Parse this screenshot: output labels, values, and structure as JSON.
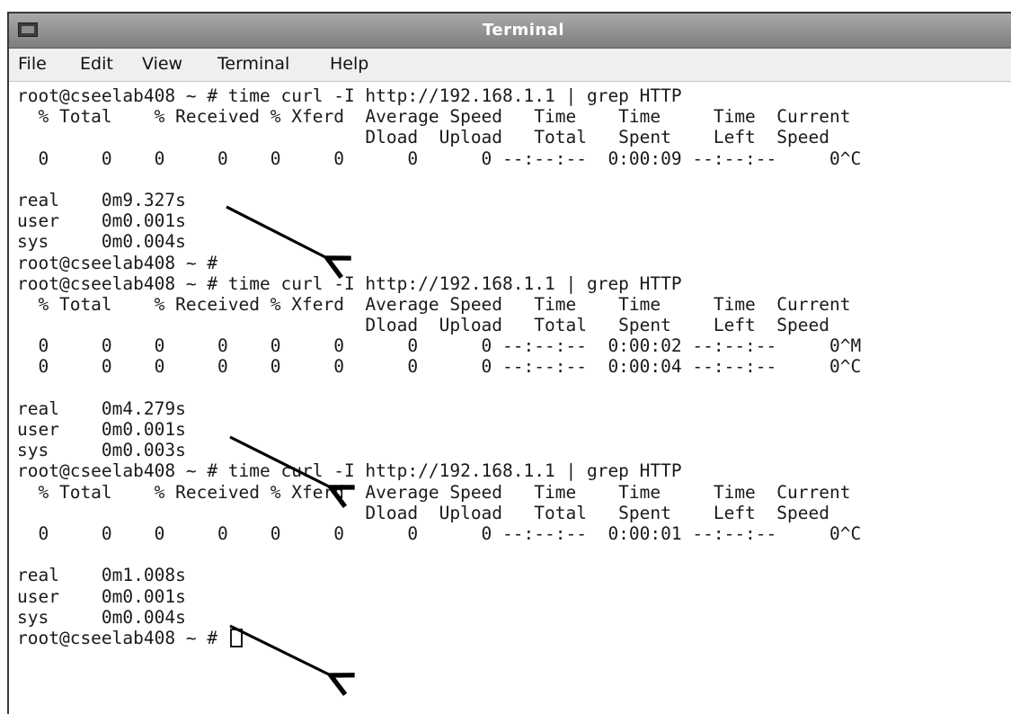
{
  "window": {
    "title": "Terminal",
    "app_icon": "terminal-app-icon"
  },
  "menu": [
    "File",
    "Edit",
    "View",
    "Terminal",
    "Help"
  ],
  "terminal": {
    "lines": [
      "root@cseelab408 ~ # time curl -I http://192.168.1.1 | grep HTTP",
      "  % Total    % Received % Xferd  Average Speed   Time    Time     Time  Current",
      "                                 Dload  Upload   Total   Spent    Left  Speed",
      "  0     0    0     0    0     0      0      0 --:--:--  0:00:09 --:--:--     0^C",
      "",
      "real    0m9.327s",
      "user    0m0.001s",
      "sys     0m0.004s",
      "root@cseelab408 ~ #",
      "root@cseelab408 ~ # time curl -I http://192.168.1.1 | grep HTTP",
      "  % Total    % Received % Xferd  Average Speed   Time    Time     Time  Current",
      "                                 Dload  Upload   Total   Spent    Left  Speed",
      "  0     0    0     0    0     0      0      0 --:--:--  0:00:02 --:--:--     0^M",
      "  0     0    0     0    0     0      0      0 --:--:--  0:00:04 --:--:--     0^C",
      "",
      "real    0m4.279s",
      "user    0m0.001s",
      "sys     0m0.003s",
      "root@cseelab408 ~ # time curl -I http://192.168.1.1 | grep HTTP",
      "  % Total    % Received % Xferd  Average Speed   Time    Time     Time  Current",
      "                                 Dload  Upload   Total   Spent    Left  Speed",
      "  0     0    0     0    0     0      0      0 --:--:--  0:00:01 --:--:--     0^C",
      "",
      "real    0m1.008s",
      "user    0m0.001s",
      "sys     0m0.004s"
    ],
    "prompt": "root@cseelab408 ~ #"
  },
  "colors": {
    "text": "#1a1a1a",
    "titlebar": "#8e8e8e",
    "title_text": "#ffffff",
    "arrow": "#000000"
  }
}
